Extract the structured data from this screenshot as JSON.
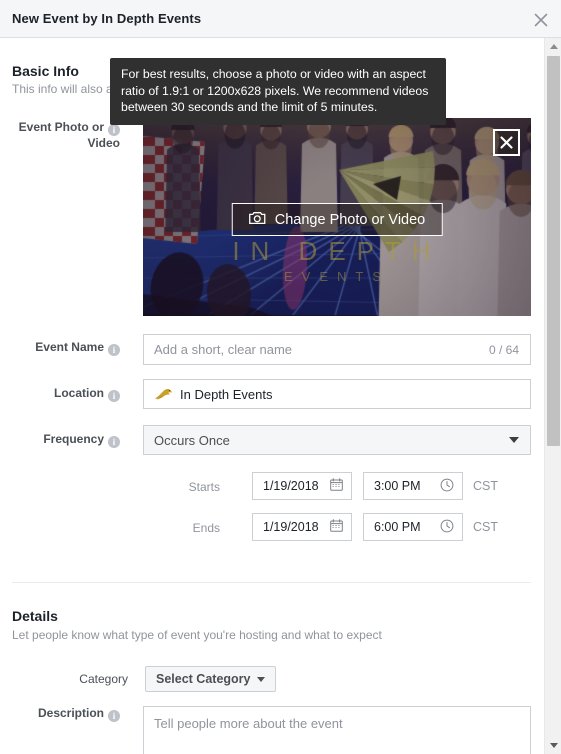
{
  "header": {
    "title": "New Event by In Depth Events",
    "close_label": "×"
  },
  "scrollbar": {
    "up_label": "▲",
    "down_label": "▼"
  },
  "basic_info": {
    "title": "Basic Info",
    "subtitle": "This info will also a"
  },
  "tooltip": {
    "text": "For best results, choose a photo or video with an aspect ratio of 1.9:1 or 1200x628 pixels. We recommend videos between 30 seconds and the limit of 5 minutes."
  },
  "photo": {
    "label_line1": "Event Photo or",
    "label_line2": "Video",
    "change_button": "Change Photo or Video",
    "remove_label": "✕",
    "watermark_line1": "IN DEPTH",
    "watermark_line2": "EVENTS"
  },
  "event_name": {
    "label": "Event Name",
    "placeholder": "Add a short, clear name",
    "value": "",
    "counter": "0 / 64"
  },
  "location": {
    "label": "Location",
    "value": "In Depth Events",
    "icon": "bird-logo-icon"
  },
  "frequency": {
    "label": "Frequency",
    "value": "Occurs Once",
    "options": [
      "Occurs Once"
    ]
  },
  "starts": {
    "label": "Starts",
    "date": "1/19/2018",
    "time": "3:00 PM",
    "timezone": "CST"
  },
  "ends": {
    "label": "Ends",
    "date": "1/19/2018",
    "time": "6:00 PM",
    "timezone": "CST"
  },
  "details": {
    "title": "Details",
    "subtitle": "Let people know what type of event you're hosting and what to expect"
  },
  "category": {
    "label": "Category",
    "value": "Select Category"
  },
  "description": {
    "label": "Description",
    "placeholder": "Tell people more about the event",
    "value": ""
  },
  "colors": {
    "header_bg": "#f5f6f7",
    "border": "#ccd0d5",
    "text_primary": "#1d2129",
    "text_muted": "#90949c",
    "tooltip_bg": "#303030",
    "brand_gold": "#ad9b3c"
  }
}
